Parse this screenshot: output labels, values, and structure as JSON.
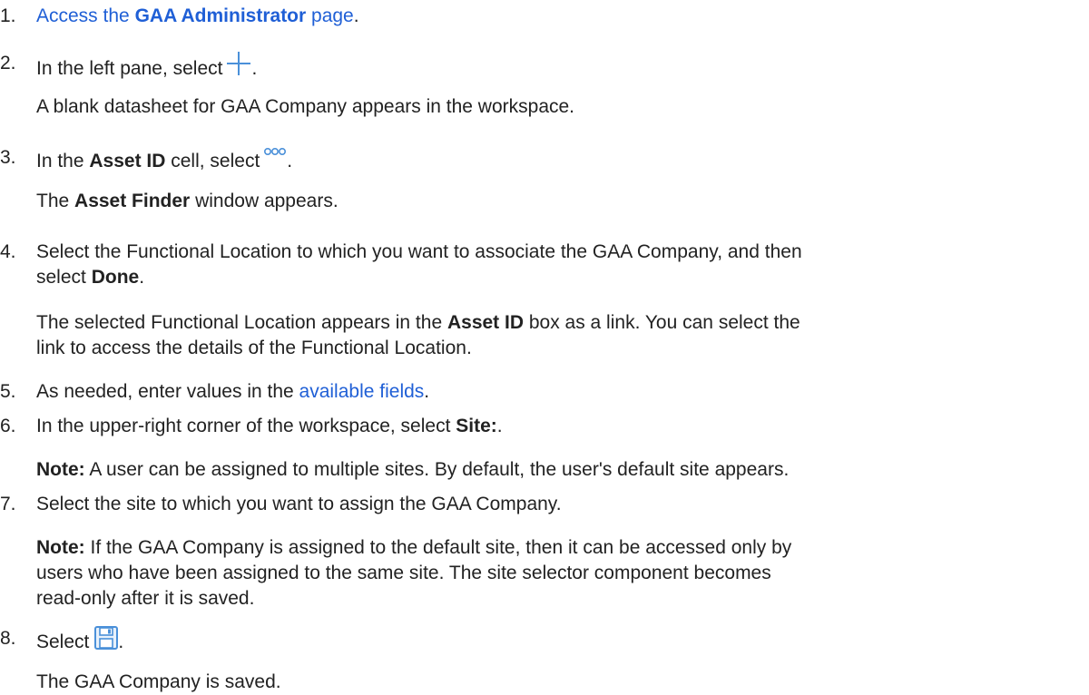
{
  "steps": [
    {
      "number": "1.",
      "pre": "Access the ",
      "link_bold": "GAA Administrator",
      "link_post": " page",
      "post": "."
    },
    {
      "number": "2.",
      "text": "In the left pane, select",
      "icon": "plus-icon",
      "post": ".",
      "result": "A blank datasheet for GAA Company appears in the workspace."
    },
    {
      "number": "3.",
      "pre": "In the ",
      "bold": "Asset ID",
      "post": " cell, select",
      "icon": "ellipsis-dots-icon",
      "end": ".",
      "result_pre": "The ",
      "result_bold": "Asset Finder",
      "result_post": " window appears."
    },
    {
      "number": "4.",
      "line1": "Select the Functional Location to which you want to associate the GAA Company, and then",
      "line2_pre": "select ",
      "line2_bold": "Done",
      "line2_post": ".",
      "result_line1_pre": "The selected Functional Location appears in the ",
      "result_line1_bold": "Asset ID",
      "result_line1_post": " box as a link. You can select the",
      "result_line2": "link to access the details of the Functional Location."
    },
    {
      "number": "5.",
      "pre": "As needed, enter values in the ",
      "link": "available fields",
      "post": "."
    },
    {
      "number": "6.",
      "pre": "In the upper-right corner of the workspace, select ",
      "bold": "Site:",
      "post": ".",
      "note_label": "Note:",
      "note_text": " A user can be assigned to multiple sites. By default, the user's default site appears."
    },
    {
      "number": "7.",
      "text": "Select the site to which you want to assign the GAA Company.",
      "note_label": "Note:",
      "note_line1": " If the GAA Company is assigned to the default site, then it can be accessed only by",
      "note_line2": "users who have been assigned to the same site. The site selector component becomes",
      "note_line3": "read-only after it is saved."
    },
    {
      "number": "8.",
      "text": "Select",
      "icon": "save-icon",
      "post": ".",
      "result": "The GAA Company is saved."
    }
  ],
  "colors": {
    "link": "#1f5fd6",
    "text": "#222222",
    "icon_blue": "#4a90d9"
  }
}
